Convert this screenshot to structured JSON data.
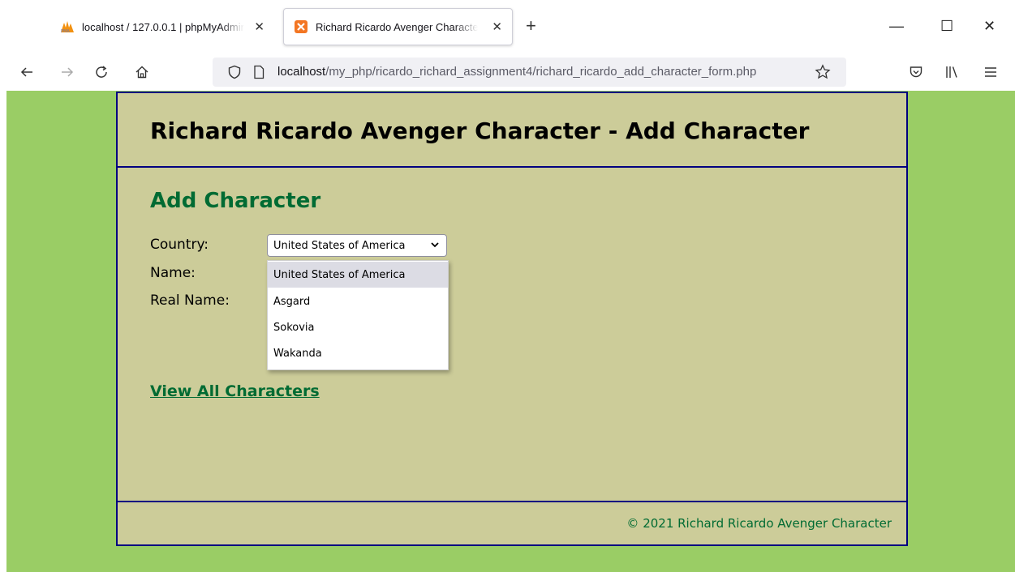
{
  "browser": {
    "tabs": [
      {
        "title": "localhost / 127.0.0.1 | phpMyAdmin",
        "active": false,
        "icon": "phpmyadmin-icon"
      },
      {
        "title": "Richard Ricardo Avenger Character",
        "active": true,
        "icon": "xampp-icon"
      }
    ],
    "close_glyph": "✕",
    "new_tab_glyph": "+",
    "url_host": "localhost",
    "url_path": "/my_php/ricardo_richard_assignment4/richard_ricardo_add_character_form.php",
    "window_buttons": {
      "minimize": "—",
      "maximize": "☐",
      "close": "✕"
    }
  },
  "page": {
    "title": "Richard Ricardo Avenger Character - Add Character",
    "heading": "Add Character",
    "form": {
      "country_label": "Country:",
      "name_label": "Name:",
      "real_name_label": "Real Name:",
      "country_selected": "United States of America",
      "country_options": [
        "United States of America",
        "Asgard",
        "Sokovia",
        "Wakanda"
      ]
    },
    "view_all_link": "View All Characters",
    "footer": "© 2021 Richard Ricardo Avenger Character"
  },
  "colors": {
    "background": "#9acd65",
    "page": "#cccc99",
    "border": "#000080",
    "heading_green": "#006b33"
  }
}
